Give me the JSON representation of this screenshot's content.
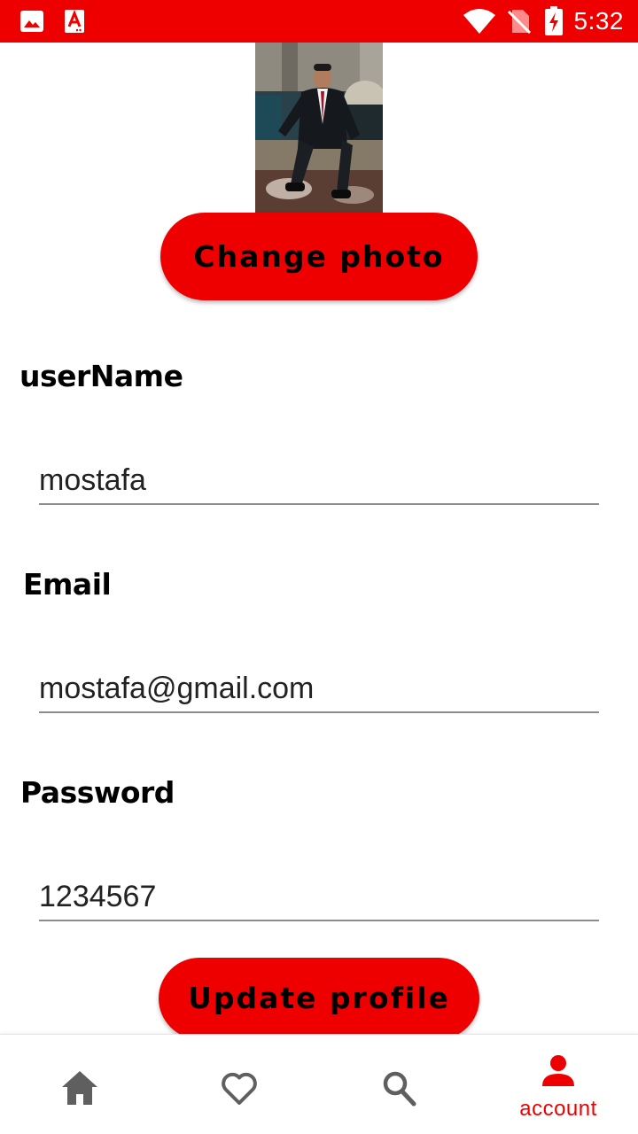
{
  "status_bar": {
    "time": "5:32",
    "background": "#ee0000",
    "icons": [
      "gallery-icon",
      "pdf-app-icon",
      "wifi-icon",
      "no-sim-icon",
      "battery-charging-icon"
    ]
  },
  "profile": {
    "change_photo_label": "Change photo"
  },
  "form": {
    "username": {
      "label": "userName",
      "value": "mostafa"
    },
    "email": {
      "label": "Email",
      "value": "mostafa@gmail.com"
    },
    "password": {
      "label": "Password",
      "value": "1234567"
    },
    "update_label": "Update profile"
  },
  "bottom_nav": {
    "items": [
      {
        "icon": "home-icon",
        "label": "",
        "active": false
      },
      {
        "icon": "heart-outline-icon",
        "label": "",
        "active": false
      },
      {
        "icon": "search-icon",
        "label": "",
        "active": false
      },
      {
        "icon": "person-icon",
        "label": "account",
        "active": true
      }
    ],
    "active_color": "#ee0000",
    "inactive_color": "#5f5f5f"
  },
  "colors": {
    "accent": "#ee0000",
    "input_underline": "#8c8c8c"
  }
}
